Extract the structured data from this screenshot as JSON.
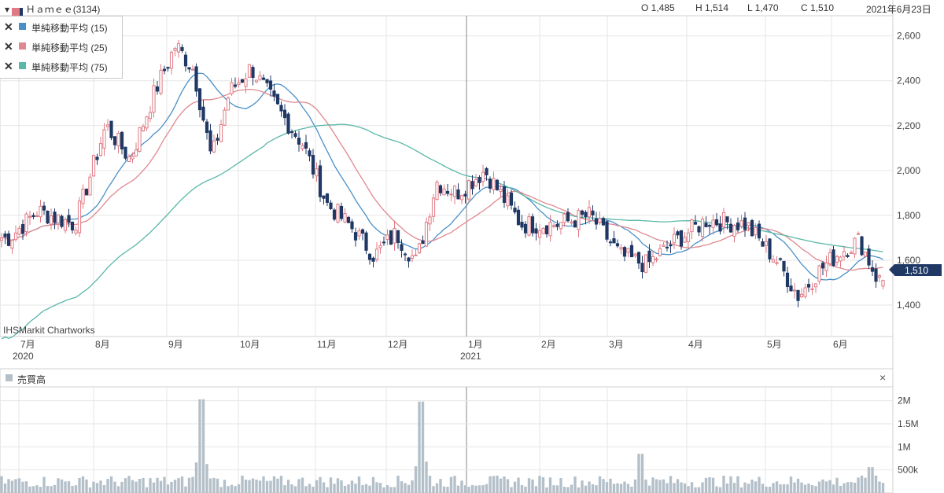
{
  "header": {
    "symbol": "Ｈａｍｅｅ(3134)",
    "open": "O 1,485",
    "high": "H 1,514",
    "low": "L 1,470",
    "close": "C 1,510",
    "date": "2021年6月23日"
  },
  "legend": [
    {
      "label": "単純移動平均 (15)",
      "color": "#4a90c8"
    },
    {
      "label": "単純移動平均 (25)",
      "color": "#e08890"
    },
    {
      "label": "単純移動平均 (75)",
      "color": "#5ab8a8"
    }
  ],
  "watermark": "IHSMarkit Chartworks",
  "last_price_label": "1,510",
  "volume_panel": {
    "title": "売買高",
    "close_symbol": "×"
  },
  "colors": {
    "up": "#e07a84",
    "down": "#1f3864",
    "volume": "#b4c0c9",
    "grid": "#e6e6e6"
  },
  "chart_data": {
    "type": "candlestick",
    "y_ticks": [
      "2,600",
      "2,400",
      "2,200",
      "2,000",
      "1,800",
      "1,600",
      "1,400"
    ],
    "y_tick_values": [
      2600,
      2400,
      2200,
      2000,
      1800,
      1600,
      1400
    ],
    "ylim": [
      1260,
      2690
    ],
    "x_ticks": [
      "7月",
      "8月",
      "9月",
      "10月",
      "11月",
      "12月",
      "1月",
      "2月",
      "3月",
      "4月",
      "5月",
      "6月"
    ],
    "x_tick_dates": [
      "2020-07",
      "2020-08",
      "2020-09",
      "2020-10",
      "2020-11",
      "2020-12",
      "2021-01",
      "2021-02",
      "2021-03",
      "2021-04",
      "2021-05",
      "2021-06"
    ],
    "year_labels": [
      {
        "label": "2020",
        "month": "7月"
      },
      {
        "label": "2021",
        "month": "1月"
      }
    ],
    "last": {
      "date": "2021-06-23",
      "open": 1485,
      "high": 1514,
      "low": 1470,
      "close": 1510
    },
    "close_path": [
      {
        "m": "2020-06",
        "v": 1700
      },
      {
        "m": "2020-07",
        "v": 1820
      },
      {
        "m": "2020-07",
        "v": 1760
      },
      {
        "m": "2020-08",
        "v": 2200
      },
      {
        "m": "2020-08",
        "v": 2050
      },
      {
        "m": "2020-08",
        "v": 2350
      },
      {
        "m": "2020-09",
        "v": 2560
      },
      {
        "m": "2020-09",
        "v": 2450
      },
      {
        "m": "2020-09",
        "v": 2050
      },
      {
        "m": "2020-09",
        "v": 2350
      },
      {
        "m": "2020-10",
        "v": 2460
      },
      {
        "m": "2020-10",
        "v": 2280
      },
      {
        "m": "2020-10",
        "v": 2120
      },
      {
        "m": "2020-11",
        "v": 1850
      },
      {
        "m": "2020-11",
        "v": 1750
      },
      {
        "m": "2020-11",
        "v": 1620
      },
      {
        "m": "2020-12",
        "v": 1720
      },
      {
        "m": "2020-12",
        "v": 1590
      },
      {
        "m": "2020-12",
        "v": 1950
      },
      {
        "m": "2020-12",
        "v": 1900
      },
      {
        "m": "2021-01",
        "v": 2000
      },
      {
        "m": "2021-01",
        "v": 1760
      },
      {
        "m": "2021-02",
        "v": 1760
      },
      {
        "m": "2021-02",
        "v": 1800
      },
      {
        "m": "2021-03",
        "v": 1620
      },
      {
        "m": "2021-03",
        "v": 1580
      },
      {
        "m": "2021-03",
        "v": 1680
      },
      {
        "m": "2021-04",
        "v": 1780
      },
      {
        "m": "2021-04",
        "v": 1760
      },
      {
        "m": "2021-05",
        "v": 1600
      },
      {
        "m": "2021-05",
        "v": 1440
      },
      {
        "m": "2021-05",
        "v": 1560
      },
      {
        "m": "2021-06",
        "v": 1640
      },
      {
        "m": "2021-06",
        "v": 1690
      },
      {
        "m": "2021-06",
        "v": 1510
      }
    ],
    "ma_labels": [
      "単純移動平均 (15)",
      "単純移動平均 (25)",
      "単純移動平均 (75)"
    ],
    "volume_ticks": [
      "2M",
      "1.5M",
      "1M",
      "500k"
    ],
    "volume_tick_values": [
      2000000,
      1500000,
      1000000,
      500000
    ],
    "volume_ylim": [
      0,
      2300000
    ],
    "volume_spikes": [
      {
        "m": "2020-09",
        "v": 2030000
      },
      {
        "m": "2020-12",
        "v": 1980000
      },
      {
        "m": "2021-03",
        "v": 850000
      },
      {
        "m": "2021-06",
        "v": 560000
      }
    ]
  }
}
